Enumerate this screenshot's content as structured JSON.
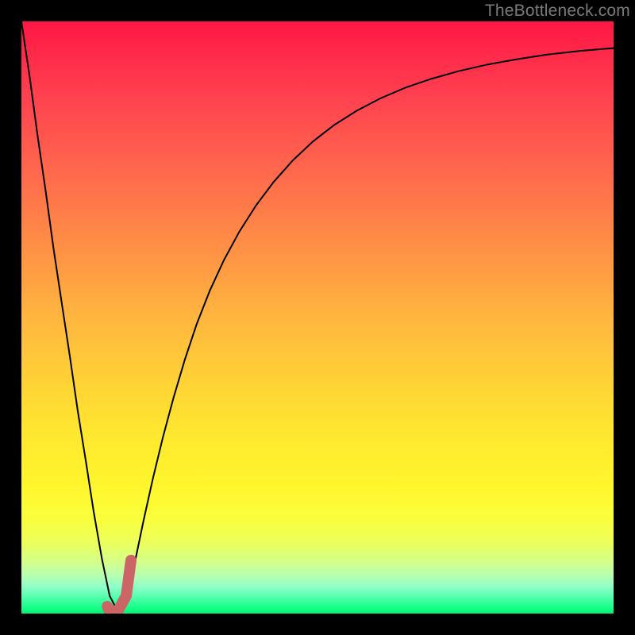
{
  "watermark": "TheBottleneck.com",
  "colors": {
    "frame": "#000000",
    "curve_stroke": "#000000",
    "accent_stroke": "#cc6666",
    "watermark_text": "#7a7a7a"
  },
  "chart_data": {
    "type": "line",
    "title": "",
    "xlabel": "",
    "ylabel": "",
    "xlim": [
      0,
      100
    ],
    "ylim": [
      0,
      100
    ],
    "grid": false,
    "legend": false,
    "series": [
      {
        "name": "bottleneck-curve",
        "x": [
          0,
          1.4,
          2.7,
          4.1,
          5.4,
          6.8,
          8.2,
          9.5,
          10.9,
          12.2,
          13.6,
          14.9,
          16.3,
          17.7,
          19.1,
          20.6,
          22.2,
          23.9,
          25.7,
          27.6,
          29.6,
          31.8,
          34.2,
          36.8,
          39.6,
          42.6,
          45.8,
          49.2,
          52.8,
          56.6,
          60.6,
          64.8,
          69.2,
          73.8,
          78.6,
          83.6,
          88.8,
          94.2,
          100.0
        ],
        "y": [
          100.0,
          90.6,
          80.9,
          71.3,
          61.8,
          52.5,
          43.3,
          34.3,
          25.6,
          17.2,
          9.2,
          3.0,
          0.3,
          2.3,
          8.4,
          15.6,
          22.8,
          29.8,
          36.5,
          42.9,
          48.9,
          54.5,
          59.7,
          64.5,
          68.9,
          72.9,
          76.5,
          79.7,
          82.5,
          84.9,
          87.0,
          88.8,
          90.3,
          91.6,
          92.7,
          93.6,
          94.4,
          95.0,
          95.5
        ]
      },
      {
        "name": "accent-j-marker",
        "x": [
          14.5,
          14.9,
          16.3,
          17.7,
          18.5
        ],
        "y": [
          1.2,
          0.3,
          0.5,
          3.0,
          9.0
        ]
      }
    ],
    "annotations": []
  }
}
